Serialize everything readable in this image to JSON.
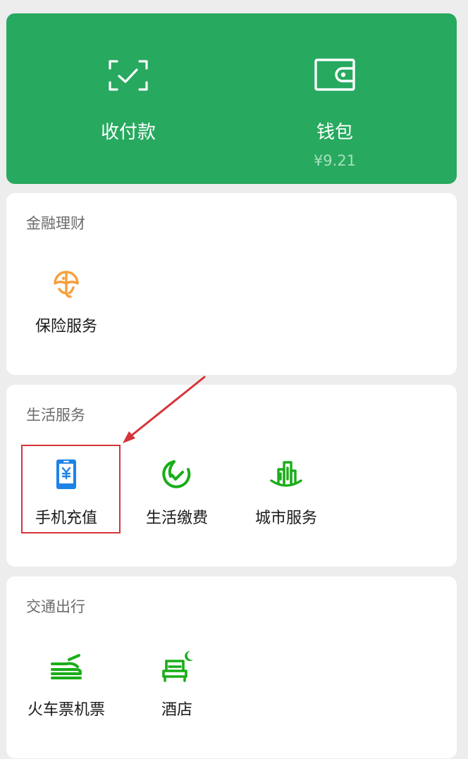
{
  "top_card": {
    "pay": {
      "label": "收付款",
      "icon": "scan-check-icon"
    },
    "wallet": {
      "label": "钱包",
      "balance": "¥9.21",
      "icon": "wallet-icon"
    }
  },
  "sections": {
    "finance": {
      "title": "金融理财",
      "items": [
        {
          "label": "保险服务",
          "icon": "insurance-umbrella-icon",
          "color": "#f5a03c"
        }
      ]
    },
    "life": {
      "title": "生活服务",
      "items": [
        {
          "label": "手机充值",
          "icon": "mobile-recharge-icon",
          "color": "#1e83e6"
        },
        {
          "label": "生活缴费",
          "icon": "utility-payment-icon",
          "color": "#1aad19"
        },
        {
          "label": "城市服务",
          "icon": "city-buildings-icon",
          "color": "#1aad19"
        }
      ]
    },
    "travel": {
      "title": "交通出行",
      "items": [
        {
          "label": "火车票机票",
          "icon": "train-plane-icon",
          "color": "#1aad19"
        },
        {
          "label": "酒店",
          "icon": "hotel-bed-icon",
          "color": "#1aad19"
        }
      ]
    }
  },
  "colors": {
    "brand_green": "#27a95f",
    "highlight_red": "#d6333a",
    "background": "#ededed"
  }
}
